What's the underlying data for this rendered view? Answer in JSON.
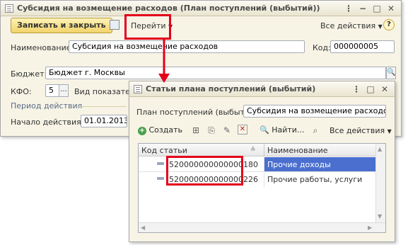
{
  "main_window": {
    "title": "Субсидия на возмещение расходов (План поступлений (выбытий))",
    "save_close_label": "Записать и закрыть",
    "goto_label": "Перейти",
    "all_actions_label": "Все действия",
    "help_label": "?",
    "name_label": "Наименование:",
    "name_value": "Субсидия на возмещение расходов",
    "code_label": "Код:",
    "code_value": "000000005",
    "budget_label": "Бюджет:",
    "budget_value": "Бюджет г. Москвы",
    "kfo_label": "КФО:",
    "kfo_value": "5",
    "kfo_select": "...",
    "indicator_label": "Вид показател",
    "period_section": "Период действия",
    "start_label": "Начало действия:",
    "start_value": "01.01.2013"
  },
  "dialog": {
    "title": "Статьи плана поступлений (выбытий)",
    "plan_label": "План поступлений (выбытий):",
    "plan_value": "Субсидия на возмещение расходов",
    "create_label": "Создать",
    "find_label": "Найти...",
    "all_actions_label": "Все действия",
    "columns": [
      "Код статьи",
      "Наименование"
    ],
    "rows": [
      {
        "code": "520000000000000180",
        "name": "Прочие доходы",
        "selected": true
      },
      {
        "code": "520000000000000226",
        "name": "Прочие работы, услуги",
        "selected": false
      }
    ]
  },
  "colors": {
    "highlight": "#e3001b",
    "selection": "#4a6fcf",
    "button_gold": "#f2d36a"
  }
}
